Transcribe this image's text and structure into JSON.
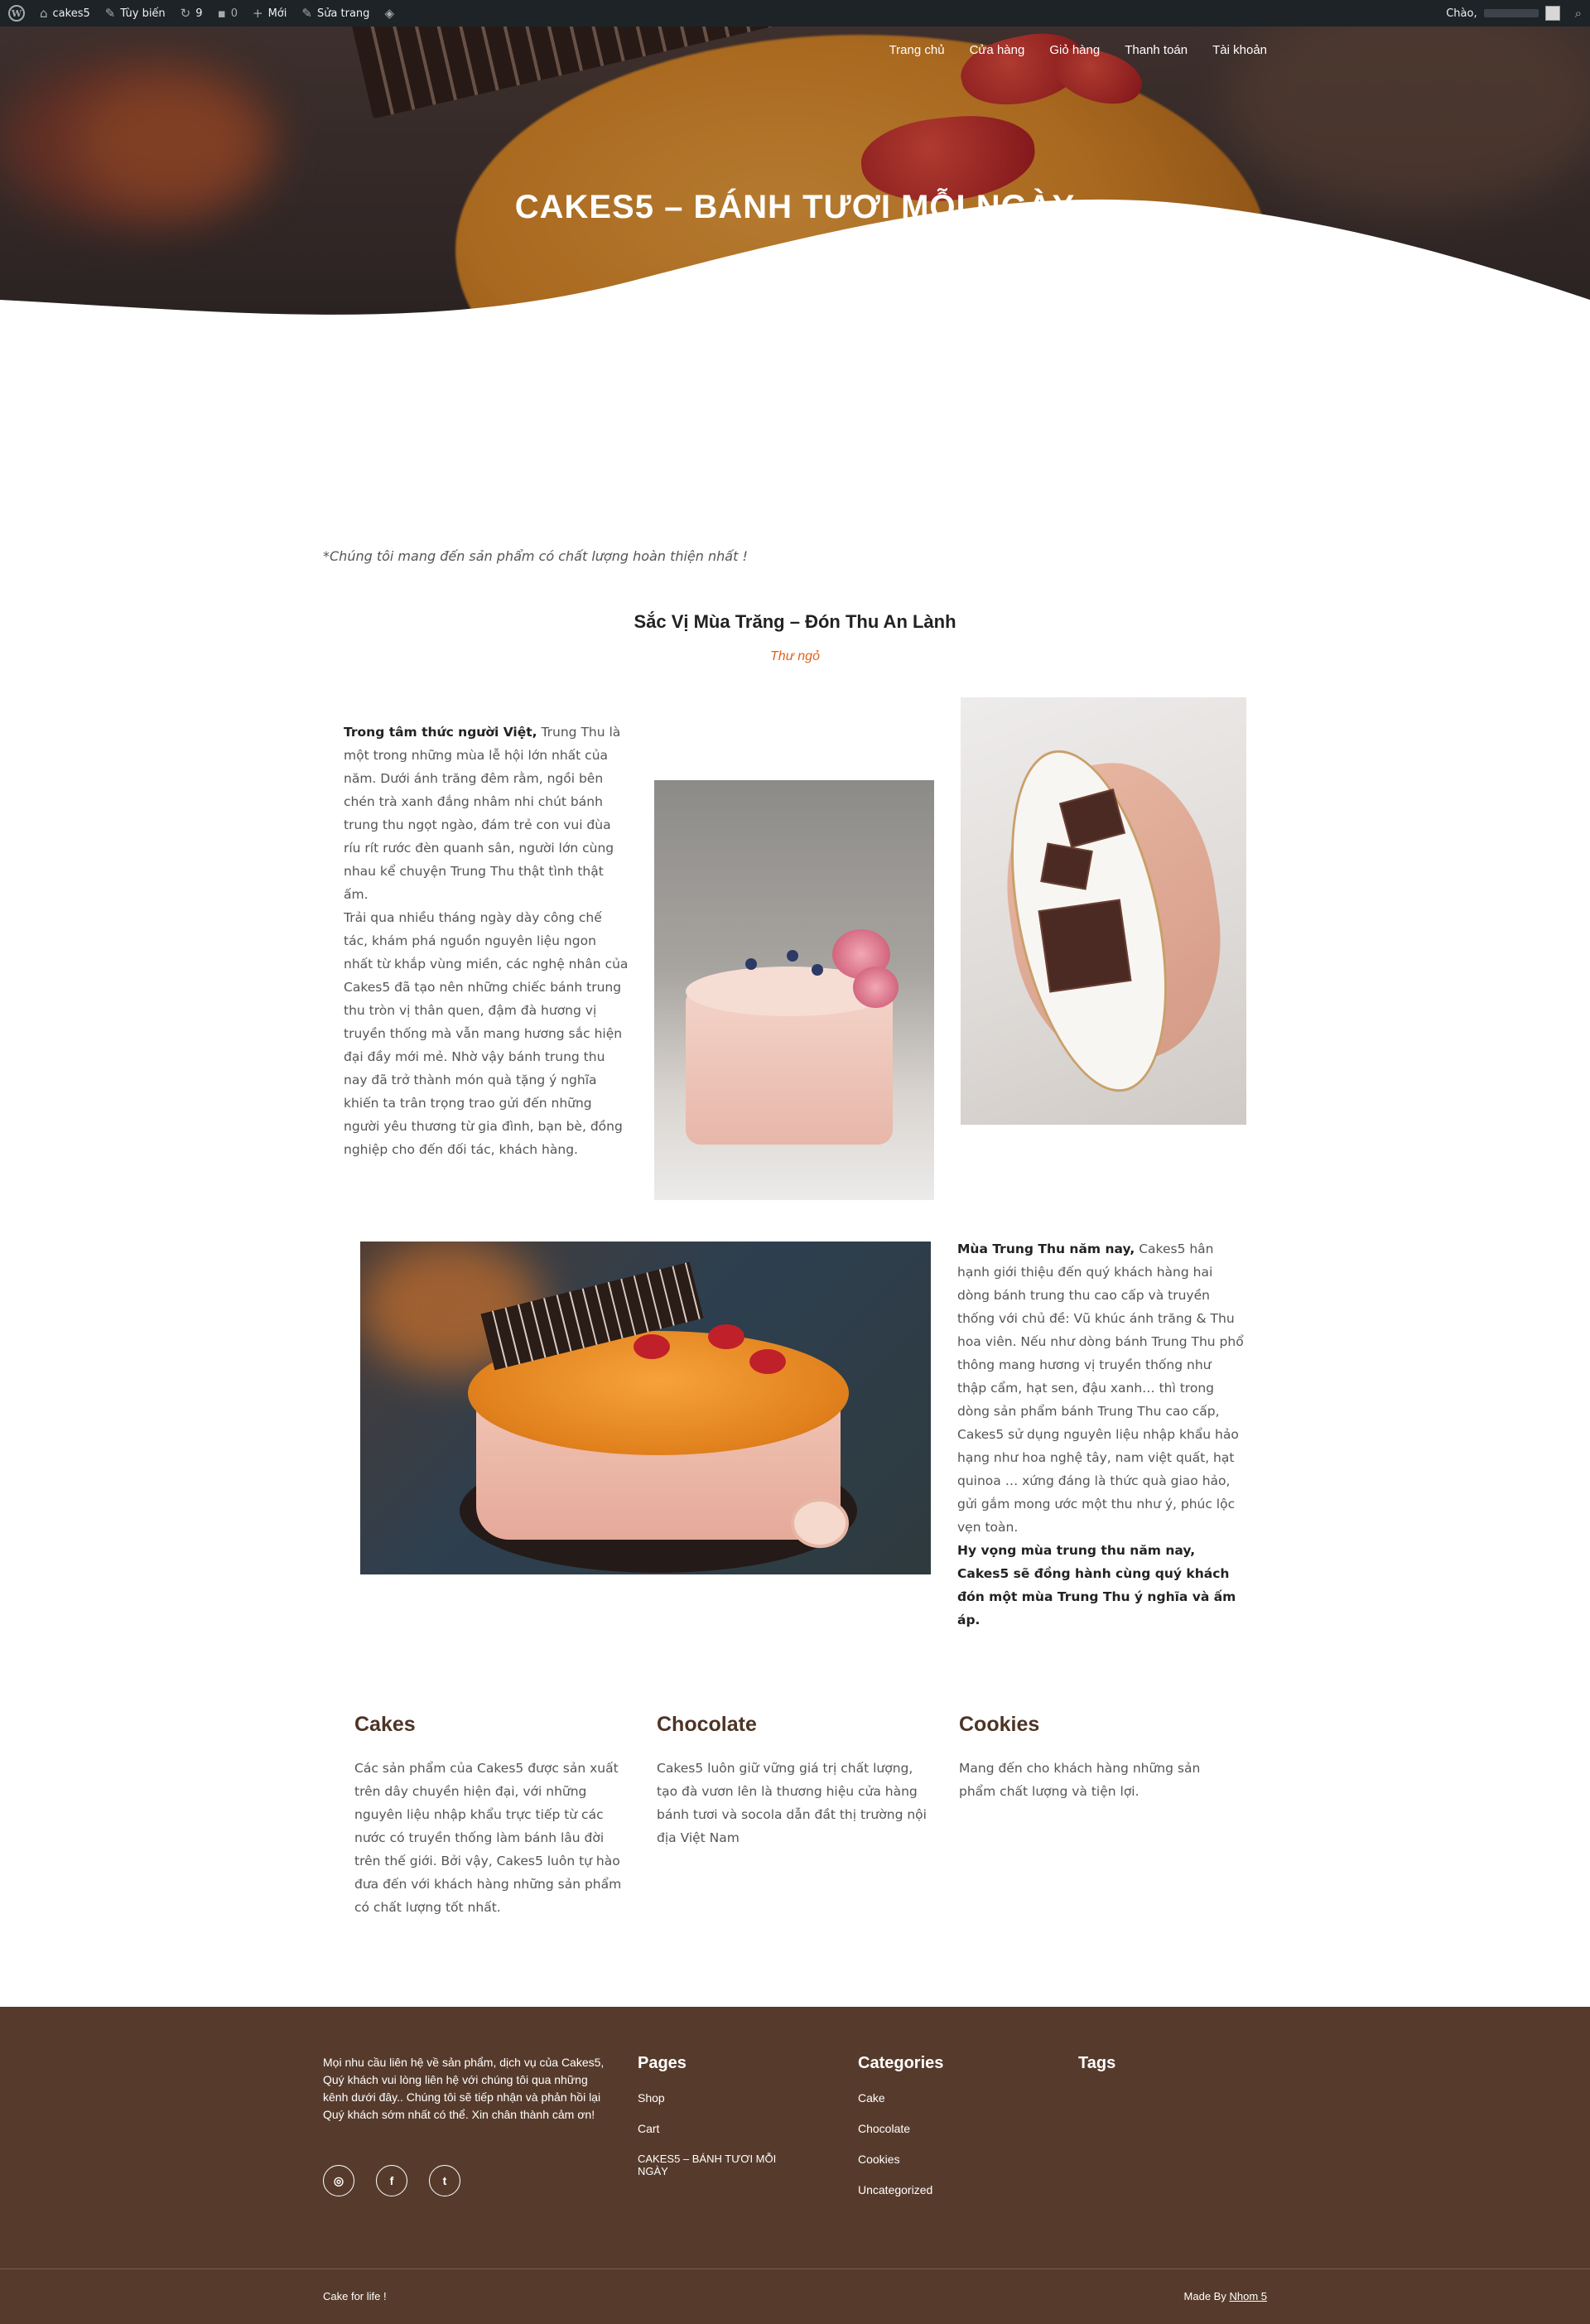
{
  "admin_bar": {
    "site_name": "cakes5",
    "customize": "Tùy biến",
    "updates_count": "9",
    "comments_count": "0",
    "new": "Mới",
    "edit_page": "Sửa trang",
    "greeting": "Chào,"
  },
  "nav": {
    "items": [
      "Trang chủ",
      "Cửa hàng",
      "Giỏ hàng",
      "Thanh toán",
      "Tài khoản"
    ]
  },
  "hero": {
    "title": "CAKES5 – BÁNH TƯƠI MỖI NGÀY"
  },
  "content": {
    "intro": "*Chúng tôi mang đến sản phẩm có chất lượng hoàn thiện nhất !",
    "section_title": "Sắc Vị Mùa Trăng – Đón Thu An Lành",
    "section_subtitle": "Thư ngỏ",
    "para1_bold": "Trong tâm thức người Việt,",
    "para1_text": " Trung Thu là một trong những mùa lễ hội lớn nhất của năm. Dưới ánh trăng đêm rằm, ngồi bên chén trà xanh đắng nhâm nhi chút bánh trung thu ngọt ngào, đám trẻ con vui đùa ríu rít rước đèn quanh sân, người lớn cùng nhau kể chuyện Trung Thu thật tình thật ấm.",
    "para1_text2": "Trải qua nhiều tháng ngày dày công chế tác, khám phá nguồn nguyên liệu ngon nhất từ khắp vùng miền, các nghệ nhân của Cakes5 đã tạo nên những chiếc bánh trung thu tròn vị thân quen, đậm đà hương vị truyền thống mà vẫn mang hương sắc hiện đại đầy mới mẻ. Nhờ vậy bánh trung thu nay đã trở thành món quà tặng ý nghĩa khiến ta trân trọng trao gửi đến những người yêu thương từ gia đình, bạn bè, đồng nghiệp cho đến đối tác, khách hàng.",
    "para2_bold": "Mùa Trung Thu năm nay,",
    "para2_text": " Cakes5 hân hạnh giới thiệu đến quý khách hàng hai dòng bánh trung thu cao cấp và truyền thống với chủ đề: Vũ khúc ánh trăng & Thu hoa viên. Nếu như dòng bánh Trung Thu phổ thông mang hương vị truyền thống như thập cẩm, hạt sen, đậu xanh… thì trong dòng sản phẩm bánh Trung Thu cao cấp, Cakes5 sử dụng nguyên liệu nhập khẩu hảo hạng như hoa nghệ tây, nam việt quất, hạt quinoa … xứng đáng là thức quà giao hảo, gửi gắm mong ước một thu như ý, phúc lộc vẹn toàn.",
    "para2_closing": "Hy vọng mùa trung thu năm nay, Cakes5 sẽ đồng hành cùng quý khách đón một mùa Trung Thu ý nghĩa và ấm áp."
  },
  "features": [
    {
      "title": "Cakes",
      "text": "Các sản phẩm của Cakes5 được sản xuất trên dây chuyền hiện đại, với những nguyên liệu nhập khẩu trực tiếp từ các nước có truyền thống làm bánh lâu đời trên thế giới. Bởi vậy, Cakes5 luôn tự hào đưa đến với khách hàng những sản phẩm có chất lượng tốt nhất."
    },
    {
      "title": "Chocolate",
      "text": "Cakes5 luôn giữ vững giá trị chất lượng, tạo đà vươn lên là thương hiệu cửa hàng bánh tươi và socola dẫn đầt thị trường nội địa Việt Nam"
    },
    {
      "title": "Cookies",
      "text": "Mang đến cho khách hàng những sản phẩm chất lượng và tiện lợi."
    }
  ],
  "footer": {
    "about": "Mọi nhu cầu liên hệ về sản phẩm, dịch vụ của Cakes5, Quý khách vui lòng liên hệ với chúng tôi qua những kênh dưới đây.. Chúng tôi sẽ tiếp nhận và phản hồi lại Quý khách sớm nhất có thể. Xin chân thành cảm ơn!",
    "pages_title": "Pages",
    "pages": [
      "Shop",
      "Cart",
      "CAKES5 – BÁNH TƯƠI MỖI NGÀY"
    ],
    "categories_title": "Categories",
    "categories": [
      "Cake",
      "Chocolate",
      "Cookies",
      "Uncategorized"
    ],
    "tags_title": "Tags",
    "bottom_left": "Cake for life !",
    "made_by_prefix": "Made By ",
    "made_by_link": "Nhom 5"
  },
  "colors": {
    "accent_orange": "#e2621b",
    "footer_bg": "#563b2c",
    "heading_brown": "#4d3425",
    "admin_bar": "#1d2327"
  },
  "icons": [
    "wordpress-icon",
    "home-icon",
    "brush-icon",
    "updates-icon",
    "comments-icon",
    "plus-icon",
    "pencil-icon",
    "diamond-icon",
    "search-icon",
    "instagram-icon",
    "facebook-icon",
    "twitter-icon"
  ]
}
